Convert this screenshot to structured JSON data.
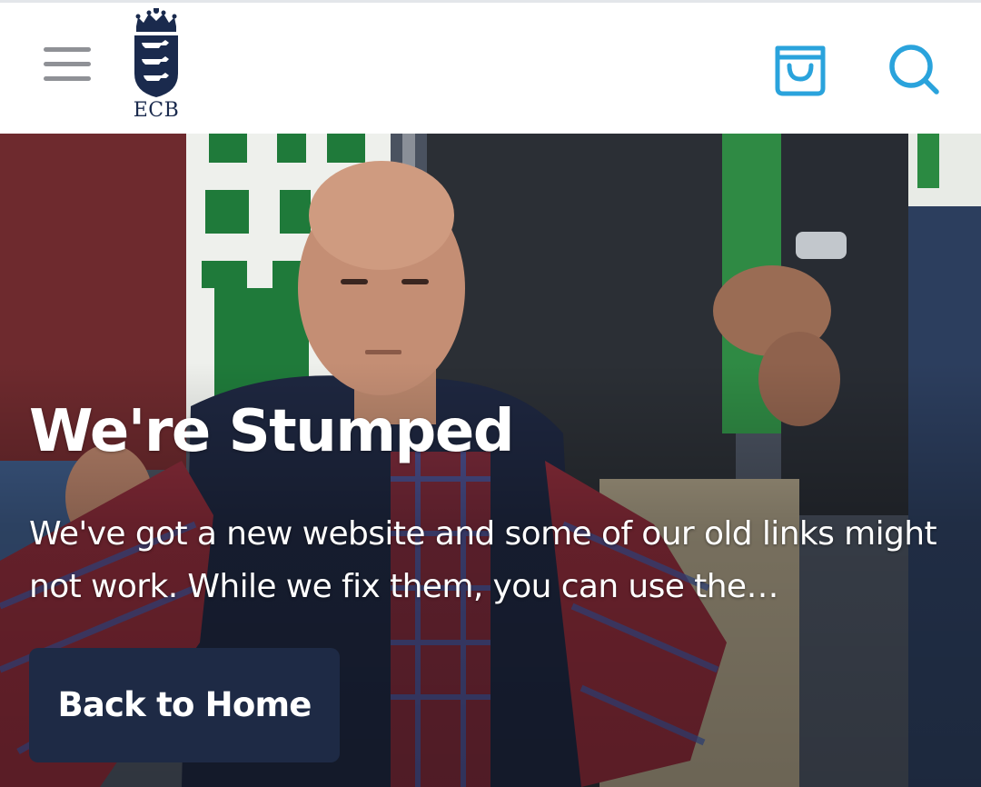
{
  "header": {
    "menu_icon": "hamburger-menu-icon",
    "logo_text": "ECB",
    "cart_icon": "shopping-bag-icon",
    "search_icon": "search-icon",
    "accent_color": "#2aa3dc"
  },
  "hero": {
    "title": "We're Stumped",
    "message": "We've got a new website and some of our old links might not work. While we fix them, you can use the…",
    "button_label": "Back to Home",
    "button_color": "#1e2a45"
  }
}
